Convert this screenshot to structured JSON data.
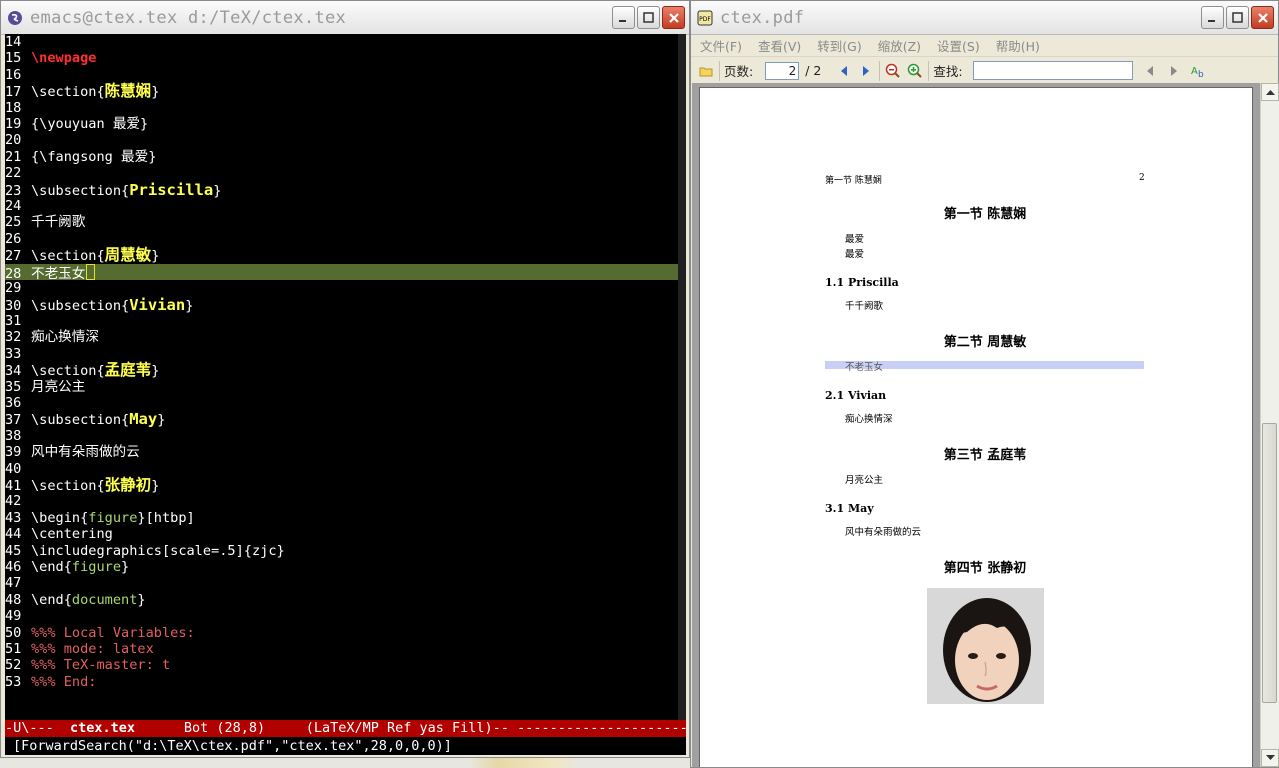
{
  "emacs": {
    "title": "emacs@ctex.tex d:/TeX/ctex.tex",
    "lines": [
      {
        "n": "14",
        "parts": []
      },
      {
        "n": "15",
        "parts": [
          {
            "t": "\\newpage",
            "c": "kw-red"
          }
        ]
      },
      {
        "n": "16",
        "parts": []
      },
      {
        "n": "17",
        "parts": [
          {
            "t": "\\section{"
          },
          {
            "t": "陈慧娴",
            "c": "kw-yel"
          },
          {
            "t": "}"
          }
        ]
      },
      {
        "n": "18",
        "parts": []
      },
      {
        "n": "19",
        "parts": [
          {
            "t": "{\\youyuan 最爱}"
          }
        ]
      },
      {
        "n": "20",
        "parts": []
      },
      {
        "n": "21",
        "parts": [
          {
            "t": "{\\fangsong 最爱}"
          }
        ]
      },
      {
        "n": "22",
        "parts": []
      },
      {
        "n": "23",
        "parts": [
          {
            "t": "\\subsection{"
          },
          {
            "t": "Priscilla",
            "c": "kw-yel"
          },
          {
            "t": "}"
          }
        ]
      },
      {
        "n": "24",
        "parts": []
      },
      {
        "n": "25",
        "parts": [
          {
            "t": "千千阙歌"
          }
        ]
      },
      {
        "n": "26",
        "parts": []
      },
      {
        "n": "27",
        "parts": [
          {
            "t": "\\section{"
          },
          {
            "t": "周慧敏",
            "c": "kw-yel"
          },
          {
            "t": "}"
          }
        ]
      },
      {
        "n": "28",
        "hl": true,
        "cursor": true,
        "parts": [
          {
            "t": "不老玉女"
          }
        ]
      },
      {
        "n": "29",
        "parts": []
      },
      {
        "n": "30",
        "parts": [
          {
            "t": "\\subsection{"
          },
          {
            "t": "Vivian",
            "c": "kw-yel"
          },
          {
            "t": "}"
          }
        ]
      },
      {
        "n": "31",
        "parts": []
      },
      {
        "n": "32",
        "parts": [
          {
            "t": "痴心换情深"
          }
        ]
      },
      {
        "n": "33",
        "parts": []
      },
      {
        "n": "34",
        "parts": [
          {
            "t": "\\section{"
          },
          {
            "t": "孟庭苇",
            "c": "kw-yel"
          },
          {
            "t": "}"
          }
        ]
      },
      {
        "n": "35",
        "parts": [
          {
            "t": "月亮公主"
          }
        ]
      },
      {
        "n": "36",
        "parts": []
      },
      {
        "n": "37",
        "parts": [
          {
            "t": "\\subsection{"
          },
          {
            "t": "May",
            "c": "kw-yel"
          },
          {
            "t": "}"
          }
        ]
      },
      {
        "n": "38",
        "parts": []
      },
      {
        "n": "39",
        "parts": [
          {
            "t": "风中有朵雨做的云"
          }
        ]
      },
      {
        "n": "40",
        "parts": []
      },
      {
        "n": "41",
        "parts": [
          {
            "t": "\\section{"
          },
          {
            "t": "张静初",
            "c": "kw-yel"
          },
          {
            "t": "}"
          }
        ]
      },
      {
        "n": "42",
        "parts": []
      },
      {
        "n": "43",
        "parts": [
          {
            "t": "\\begin{"
          },
          {
            "t": "figure",
            "c": "kw-grn"
          },
          {
            "t": "}[htbp]"
          }
        ]
      },
      {
        "n": "44",
        "parts": [
          {
            "t": "\\centering"
          }
        ]
      },
      {
        "n": "45",
        "parts": [
          {
            "t": "\\includegraphics[scale=.5]{zjc}"
          }
        ]
      },
      {
        "n": "46",
        "parts": [
          {
            "t": "\\end{"
          },
          {
            "t": "figure",
            "c": "kw-grn"
          },
          {
            "t": "}"
          }
        ]
      },
      {
        "n": "47",
        "parts": []
      },
      {
        "n": "48",
        "parts": [
          {
            "t": "\\end{"
          },
          {
            "t": "document",
            "c": "kw-grn"
          },
          {
            "t": "}"
          }
        ]
      },
      {
        "n": "49",
        "parts": []
      },
      {
        "n": "50",
        "parts": [
          {
            "t": "%%% Local Variables:",
            "c": "comment"
          }
        ]
      },
      {
        "n": "51",
        "parts": [
          {
            "t": "%%% mode: latex",
            "c": "comment"
          }
        ]
      },
      {
        "n": "52",
        "parts": [
          {
            "t": "%%% TeX-master: t",
            "c": "comment"
          }
        ]
      },
      {
        "n": "53",
        "parts": [
          {
            "t": "%%% End:",
            "c": "comment"
          }
        ]
      }
    ],
    "modeline": {
      "flags": "-U\\---  ",
      "buffer": "ctex.tex",
      "position": "      Bot (28,8)     ",
      "modes": "(LaTeX/MP Ref yas Fill)-- ----------------------"
    },
    "minibuffer": "[ForwardSearch(\"d:\\TeX\\ctex.pdf\",\"ctex.tex\",28,0,0,0)]"
  },
  "pdf": {
    "title": "ctex.pdf",
    "menu": [
      "文件(F)",
      "查看(V)",
      "转到(G)",
      "缩放(Z)",
      "设置(S)",
      "帮助(H)"
    ],
    "page_label": "页数:",
    "page_value": "2",
    "page_total": "/ 2",
    "find_label": "查找:",
    "page": {
      "header_left": "第一节  陈慧娴",
      "header_right": "2",
      "sections": [
        {
          "title": "第一节   陈慧娴"
        },
        {
          "title": "第二节   周慧敏"
        },
        {
          "title": "第三节   孟庭苇"
        },
        {
          "title": "第四节   张静初"
        }
      ],
      "body": {
        "love1": "最爱",
        "love2": "最爱",
        "s11": "1.1   Priscilla",
        "qqqg": "千千阙歌",
        "blyn": "不老玉女",
        "s21": "2.1   Vivian",
        "cxhqs": "痴心换情深",
        "ylgz": "月亮公主",
        "s31": "3.1   May",
        "fzyd": "风中有朵雨做的云"
      }
    }
  },
  "colors": {
    "modeline_bg": "#b00000",
    "highlight_line": "#556b2f",
    "keyword_red": "#ff3030",
    "keyword_yellow": "#ffff50",
    "keyword_green": "#a8d870",
    "comment": "#e06060",
    "pdf_highlight": "#c8cff5"
  }
}
